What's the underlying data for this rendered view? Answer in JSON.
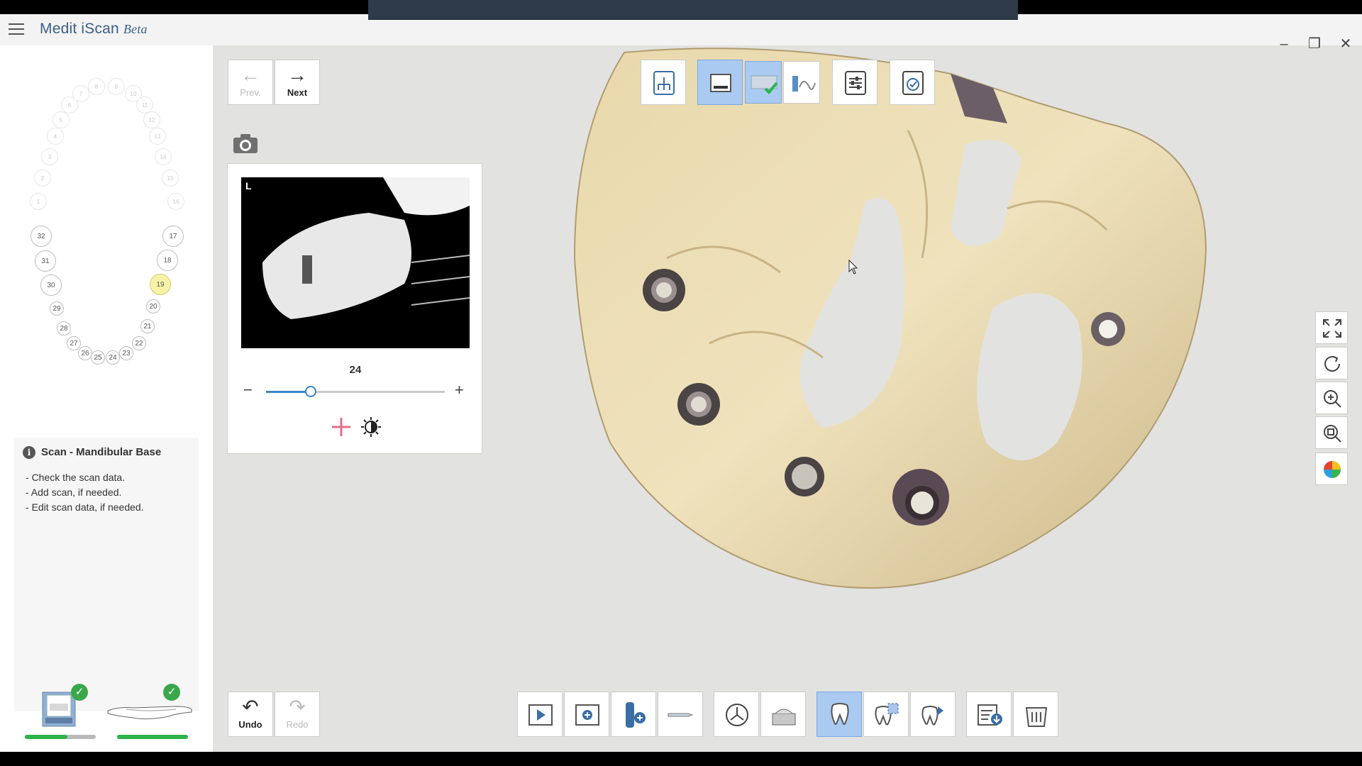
{
  "app": {
    "name": "Medit iScan",
    "badge": "Beta"
  },
  "window": {
    "minimize": "–",
    "maximize": "❐",
    "close": "✕"
  },
  "tooth_chart": {
    "upper_faint": [
      "1",
      "2",
      "3",
      "4",
      "5",
      "6",
      "7",
      "8",
      "9",
      "10",
      "11",
      "12",
      "13",
      "14",
      "15",
      "16"
    ],
    "lower_right": [
      "32",
      "31",
      "30",
      "29",
      "28",
      "27",
      "26",
      "25"
    ],
    "lower_left": [
      "24",
      "23",
      "22",
      "21",
      "20",
      "19",
      "18",
      "17"
    ],
    "selected": "19"
  },
  "info": {
    "icon": "i",
    "title": "Scan - Mandibular Base",
    "items": [
      "Check the scan data.",
      "Add scan, if needed.",
      "Edit scan data, if needed."
    ]
  },
  "stages": [
    {
      "name": "base-scan",
      "complete": true,
      "progress": 0.6
    },
    {
      "name": "antagonist-scan",
      "complete": true,
      "progress": 1.0
    }
  ],
  "nav": {
    "prev": "Prev.",
    "next": "Next",
    "prev_arrow": "←",
    "next_arrow": "→"
  },
  "history": {
    "undo": "Undo",
    "redo": "Redo",
    "undo_arrow": "↶",
    "redo_arrow": "↷"
  },
  "preview": {
    "corner_label": "L",
    "slider_value": "24",
    "slider_fraction": 0.25,
    "minus": "−",
    "plus": "+"
  },
  "check_mark": "✓"
}
